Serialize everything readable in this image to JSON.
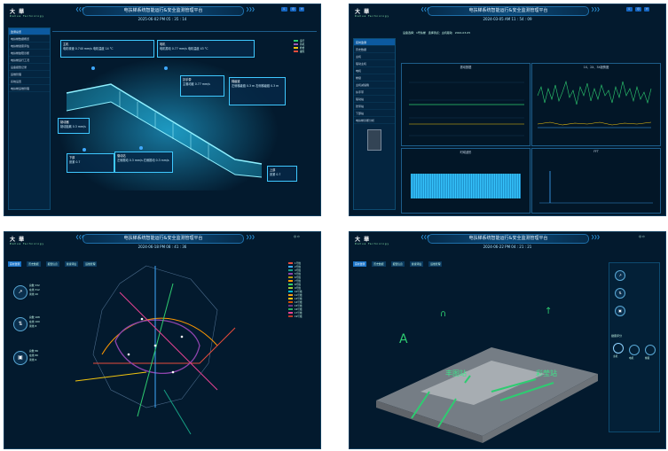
{
  "header": {
    "logo": "大 華",
    "logo_sub": "Dahua Technology",
    "title_p1": "电扶梯系统智能运行&安全监测管理平台",
    "title_p2": "电扶梯系统智能运行&安全监测管理平台",
    "title_p3": "电扶梯系统智能运行&安全监测管理平台",
    "title_p4": "电扶梯系统智能运行&安全监测管理平台"
  },
  "panel1": {
    "time": "2025-06-02 PM 05 : 35 : 14",
    "sidebar": [
      "监测总览",
      "电扶梯数据概览",
      "电扶梯健康评估",
      "电扶梯故障诊断",
      "电扶梯运行工况",
      "设备报警记录",
      "运维管理",
      "系统设置",
      "电扶梯运维管理"
    ],
    "labels": {
      "main": "主机",
      "motor": "电机",
      "handrail": "扶手带",
      "step": "梯级链",
      "brake": "制动器",
      "drive": "驱动站",
      "upper": "上部",
      "lower": "下部"
    },
    "values": {
      "main": "电机转速 0.740 mm/s  电机温度 14 °C",
      "motor": "电机振动 0.77 mm/s  电机温度 43 °C",
      "handrail": "主驱动链 0.77 mm/s",
      "step": "左侧梯级链 0.3 m  右侧梯级链 0.3 m",
      "brake": "制动距离 0.3 mm/s",
      "drive": "左侧振动 0.3 mm/s  右侧振动 0.3 mm/s",
      "upper": "张紧 0.7",
      "lower": "张紧 0.7"
    },
    "status": [
      "运行",
      "停机",
      "检修",
      "故障"
    ]
  },
  "panel2": {
    "time": "2024-03-05 AM 11 : 54 : 09",
    "selectors": [
      "设备选择：1号扶梯",
      "选择测点：主机驱动",
      "2024-03-05"
    ],
    "sidebar": [
      "实时监测",
      "历史数据",
      "主机",
      "驱动主机",
      "电机",
      "梯级",
      "主机减速箱",
      "扶手带",
      "驱动站",
      "张紧站",
      "下部站",
      "电扶梯诊断分析"
    ],
    "charts": [
      "振动数据",
      "1X、2X、3X趋势图",
      "时域波形",
      "FFT"
    ]
  },
  "panel3": {
    "time": "2024-06-18 PM 08 : 41 : 36",
    "tabs": [
      "实时监测",
      "历史数据",
      "报警信息",
      "健康评估",
      "运维管理"
    ],
    "stats": [
      "总数 332",
      "在线 312",
      "离线 20",
      "总数 168",
      "在线 160",
      "离线 8",
      "总数 86",
      "在线 80",
      "离线 6"
    ],
    "lines": [
      "1号线",
      "2号线",
      "4号线",
      "5号线",
      "6号线",
      "7号线",
      "8号线",
      "9号线",
      "10号线",
      "11号线",
      "13号线",
      "14号线",
      "15号线",
      "16号线",
      "17号线",
      "19号线"
    ]
  },
  "panel4": {
    "time": "2024-06-22 PM 04 : 21 : 21",
    "tabs": [
      "实时监测",
      "历史数据",
      "报警信息",
      "健康评估",
      "运维管理"
    ],
    "stations": [
      "丰图站",
      "彩莹站"
    ],
    "right_title": "健康评分",
    "gauges": [
      "主机",
      "电机",
      "梯级"
    ]
  }
}
